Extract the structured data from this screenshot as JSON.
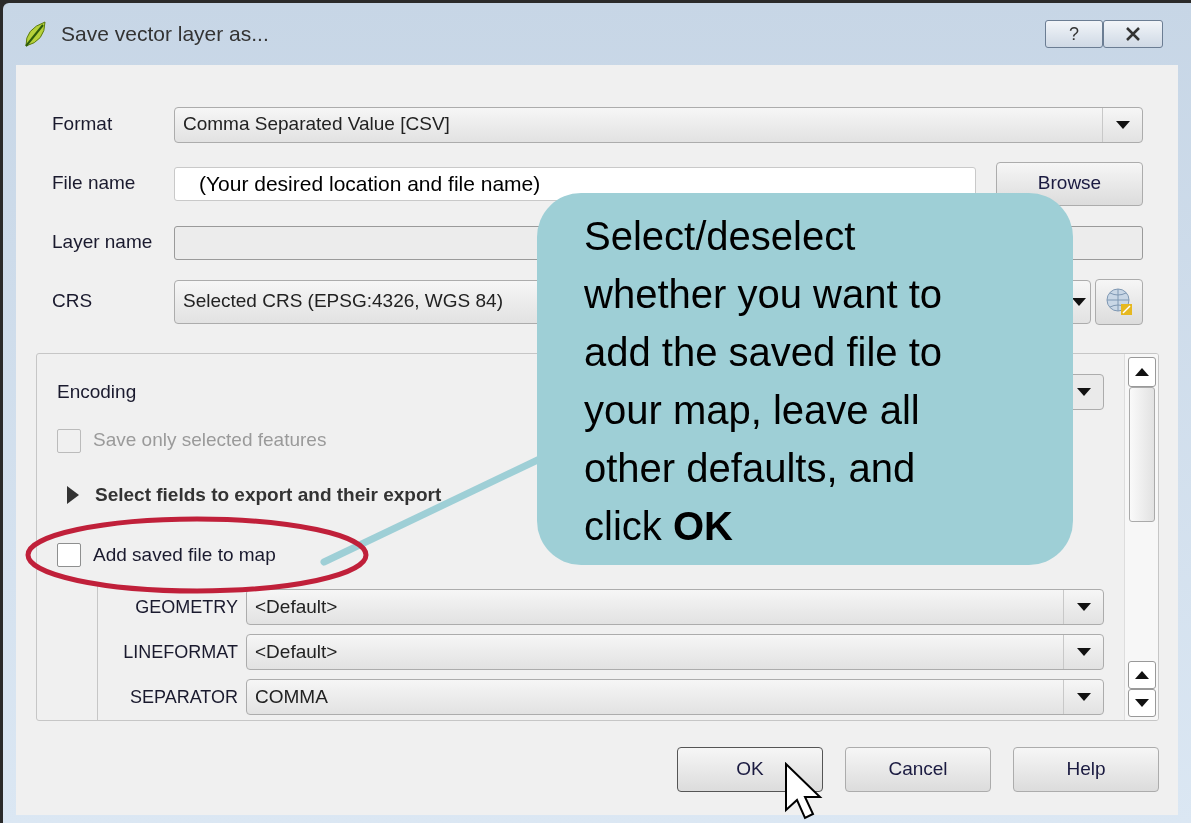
{
  "window": {
    "title": "Save vector layer as...",
    "help_button": "?"
  },
  "fields": [
    {
      "label": "Format",
      "kind": "combo",
      "value": "Comma Separated Value [CSV]"
    },
    {
      "label": "File name",
      "kind": "text",
      "value": "(Your desired location and file name)",
      "button": "Browse"
    },
    {
      "label": "Layer name",
      "kind": "text"
    },
    {
      "label": "CRS",
      "kind": "crs",
      "value": "Selected CRS (EPSG:4326, WGS 84)"
    }
  ],
  "options": {
    "encoding_label": "Encoding",
    "save_selected": {
      "label": "Save only selected features",
      "checked": false,
      "disabled": true
    },
    "fields_section": {
      "label": "Select fields to export and their export",
      "expanded": false
    },
    "add_to_map": {
      "label": "Add saved file to map",
      "checked": false
    },
    "layer_options": [
      {
        "label": "GEOMETRY",
        "value": "<Default>"
      },
      {
        "label": "LINEFORMAT",
        "value": "<Default>"
      },
      {
        "label": "SEPARATOR",
        "value": "COMMA"
      }
    ]
  },
  "buttons": [
    {
      "label": "OK",
      "focused": true
    },
    {
      "label": "Cancel",
      "focused": false
    },
    {
      "label": "Help",
      "focused": false
    }
  ],
  "callout": {
    "text": "Select/deselect whether you want to add the saved file to your map, leave all other defaults, and click **OK**"
  }
}
